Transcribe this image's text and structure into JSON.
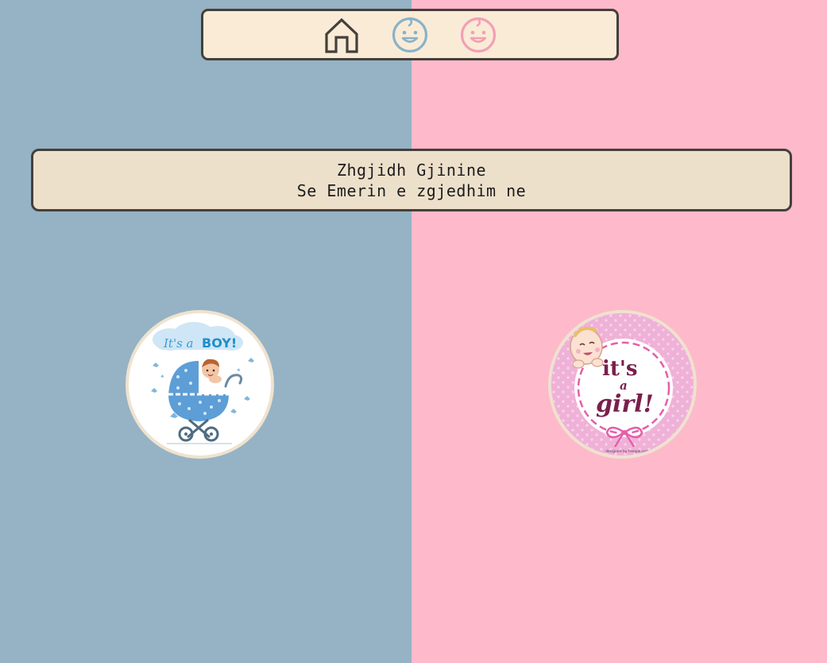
{
  "colors": {
    "boy_side": "#95b3c4",
    "girl_side": "#feb9cb",
    "navbar_bg": "#faebd7",
    "banner_bg": "#ede0cb",
    "border": "#44403b",
    "boy_icon": "#87b3c8",
    "girl_icon": "#f39fb3"
  },
  "nav": {
    "items": [
      {
        "icon": "home-icon"
      },
      {
        "icon": "baby-face-boy-icon"
      },
      {
        "icon": "baby-face-girl-icon"
      }
    ]
  },
  "banner": {
    "line1": "Zhgjidh Gjinine",
    "line2": "Se Emerin e zgjedhim ne"
  },
  "choices": {
    "boy": {
      "text_its_a": "It's a",
      "text_boy": "BOY!"
    },
    "girl": {
      "text_its": "it's",
      "text_a": "a",
      "text_girl": "girl!",
      "credit": "designed by freepik.com"
    }
  }
}
